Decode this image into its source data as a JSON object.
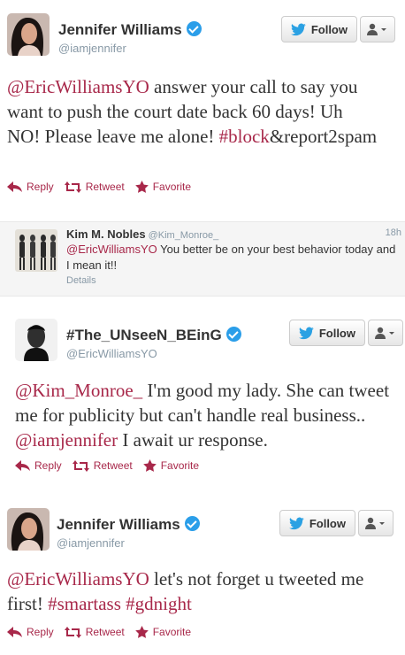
{
  "colors": {
    "accent": "#a8284a",
    "verified": "#2b9ee9",
    "twitter_blue": "#2ba1e3"
  },
  "tweets": [
    {
      "name": "Jennifer Williams",
      "handle": "@iamjennifer",
      "follow_label": "Follow",
      "text_parts": [
        "@EricWilliamsYO",
        " answer your call to say you want to push the court date back 60 days! Uh NO! Please leave me alone! ",
        "#block",
        "&report2spam"
      ],
      "actions": {
        "reply": "Reply",
        "retweet": "Retweet",
        "favorite": "Favorite"
      }
    },
    {
      "name": "#The_UNseeN_BEinG",
      "handle": "@EricWilliamsYO",
      "follow_label": "Follow",
      "text_parts": [
        "@Kim_Monroe_",
        " I'm good my lady. She can tweet me for publicity but can't handle real business.. ",
        "@iamjennifer",
        " I await ur response."
      ],
      "actions": {
        "reply": "Reply",
        "retweet": "Retweet",
        "favorite": "Favorite"
      }
    },
    {
      "name": "Jennifer Williams",
      "handle": "@iamjennifer",
      "follow_label": "Follow",
      "text_parts": [
        "@EricWilliamsYO",
        " let's not forget u tweeted me first! ",
        "#smartass",
        " ",
        "#gdnight"
      ],
      "actions": {
        "reply": "Reply",
        "retweet": "Retweet",
        "favorite": "Favorite"
      }
    }
  ],
  "reply": {
    "name": "Kim M. Nobles",
    "handle": "@Kim_Monroe_",
    "time": "18h",
    "mention": "@EricWilliamsYO",
    "text": " You better be on your best behavior today and I mean it!!",
    "details": "Details"
  }
}
